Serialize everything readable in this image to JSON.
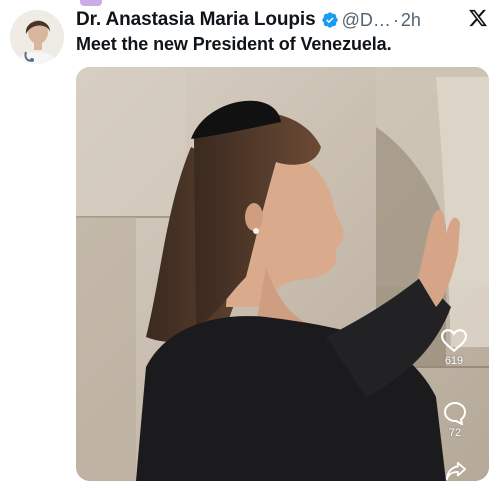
{
  "tweet": {
    "author_name": "Dr. Anastasia Maria Loupis",
    "handle": "@D…",
    "separator": "·",
    "time": "2h",
    "text": "Meet the new President of Venezuela."
  },
  "media_overlay": {
    "likes": "619",
    "comments": "72"
  },
  "icons": {
    "verified": "verified-badge-icon",
    "platform": "x-logo-icon",
    "like": "heart-icon",
    "comment": "comment-bubble-icon",
    "share": "share-icon"
  },
  "colors": {
    "verified_blue": "#1d9bf0",
    "secondary_text": "#536471",
    "primary_text": "#0f1419"
  }
}
